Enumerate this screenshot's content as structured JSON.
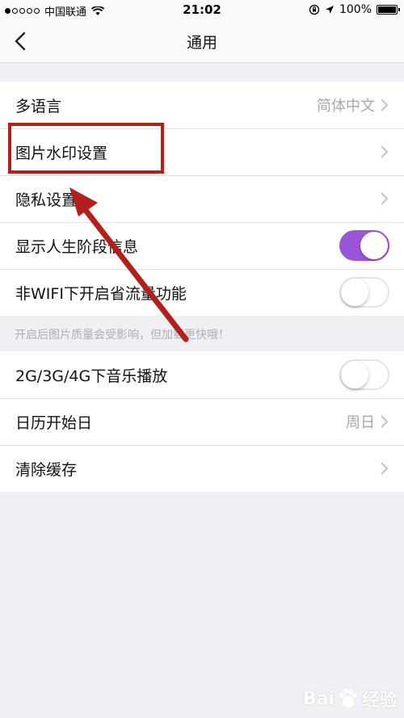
{
  "status_bar": {
    "carrier": "中国联通",
    "time": "21:02",
    "battery": "100%"
  },
  "nav": {
    "title": "通用"
  },
  "group1": [
    {
      "label": "多语言",
      "value": "简体中文",
      "type": "link"
    },
    {
      "label": "图片水印设置",
      "value": "",
      "type": "link"
    },
    {
      "label": "隐私设置",
      "value": "",
      "type": "link"
    },
    {
      "label": "显示人生阶段信息",
      "type": "toggle",
      "on": true
    },
    {
      "label": "非WIFI下开启省流量功能",
      "type": "toggle",
      "on": false
    }
  ],
  "hint": "开启后图片质量会受影响，但加载更快哦！",
  "group2": [
    {
      "label": "2G/3G/4G下音乐播放",
      "type": "toggle",
      "on": false
    },
    {
      "label": "日历开始日",
      "value": "周日",
      "type": "link"
    },
    {
      "label": "清除缓存",
      "value": "",
      "type": "link"
    }
  ],
  "colors": {
    "toggle_on": "#9b55d8",
    "annotation_red": "#b3201c",
    "background": "#efeff4"
  },
  "watermark": {
    "text_left": "Bai",
    "text_right": "经验"
  }
}
